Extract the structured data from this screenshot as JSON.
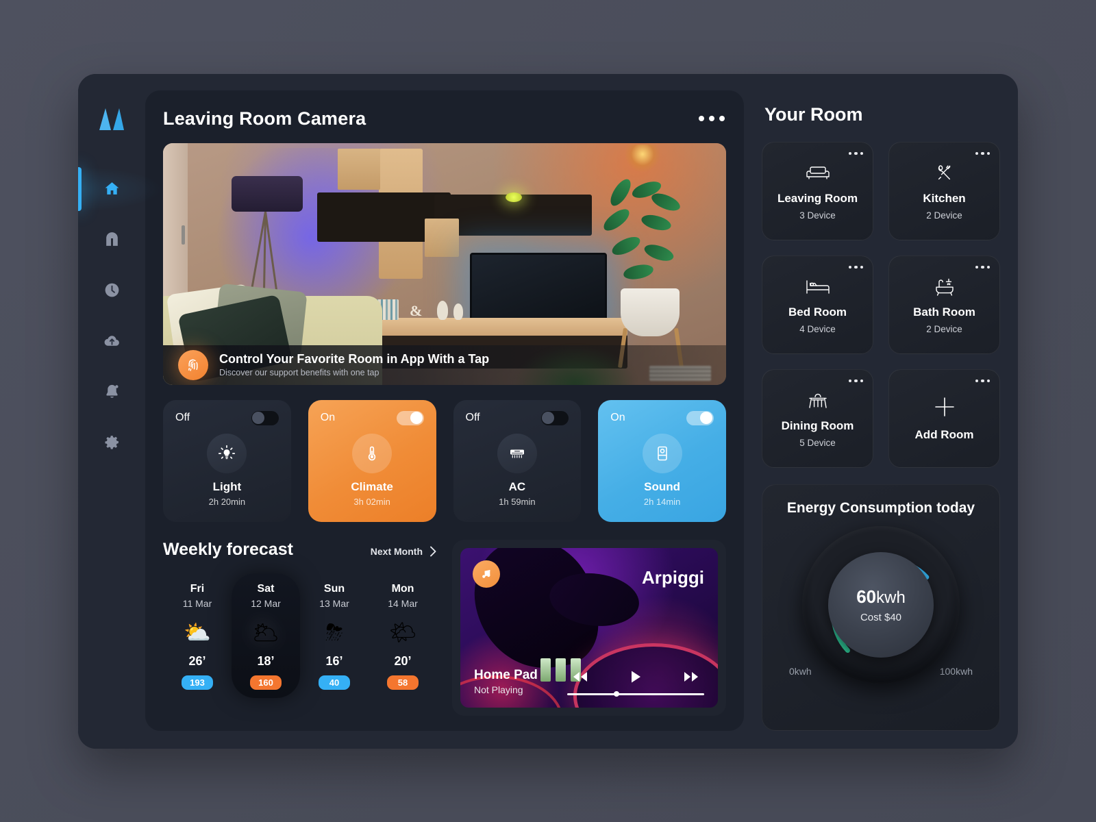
{
  "brand": {
    "logo_name": "app-logo"
  },
  "sidebar": {
    "items": [
      {
        "name": "home",
        "icon": "home-icon",
        "active": true
      },
      {
        "name": "rooms",
        "icon": "arch-door-icon",
        "active": false
      },
      {
        "name": "schedule",
        "icon": "clock-icon",
        "active": false
      },
      {
        "name": "cloud",
        "icon": "cloud-upload-icon",
        "active": false
      },
      {
        "name": "notifications",
        "icon": "bell-icon",
        "active": false
      },
      {
        "name": "settings",
        "icon": "gear-icon",
        "active": false
      }
    ]
  },
  "camera": {
    "title": "Leaving Room Camera",
    "menu_icon": "more-options-icon",
    "banner": {
      "icon": "fingerprint-icon",
      "headline": "Control Your Favorite Room in App With a Tap",
      "subtext": "Discover our support benefits with one tap"
    }
  },
  "devices": [
    {
      "state": "Off",
      "name": "Light",
      "time": "2h 20min",
      "icon": "bulb-icon",
      "on": false,
      "theme": "off"
    },
    {
      "state": "On",
      "name": "Climate",
      "time": "3h 02min",
      "icon": "thermometer-icon",
      "on": true,
      "theme": "orange"
    },
    {
      "state": "Off",
      "name": "AC",
      "time": "1h 59min",
      "icon": "air-conditioner-icon",
      "on": false,
      "theme": "off"
    },
    {
      "state": "On",
      "name": "Sound",
      "time": "2h 14min",
      "icon": "speaker-icon",
      "on": true,
      "theme": "blue"
    }
  ],
  "forecast": {
    "title": "Weekly forecast",
    "next_label": "Next Month",
    "next_icon": "chevron-right-icon",
    "days": [
      {
        "dow": "Fri",
        "date": "11 Mar",
        "icon": "partly-cloudy-day-icon",
        "glyph": "⛅",
        "temp": "26’",
        "badge": "193",
        "badge_color": "#35b0f5",
        "selected": false
      },
      {
        "dow": "Sat",
        "date": "12 Mar",
        "icon": "partly-cloudy-night-icon",
        "glyph": "🌥",
        "temp": "18’",
        "badge": "160",
        "badge_color": "#f4762f",
        "selected": true
      },
      {
        "dow": "Sun",
        "date": "13 Mar",
        "icon": "thunderstorm-icon",
        "glyph": "⛈",
        "temp": "16’",
        "badge": "40",
        "badge_color": "#35b0f5",
        "selected": false
      },
      {
        "dow": "Mon",
        "date": "14 Mar",
        "icon": "sun-haze-icon",
        "glyph": "🌤",
        "temp": "20’",
        "badge": "58",
        "badge_color": "#f4762f",
        "selected": false
      }
    ]
  },
  "music": {
    "badge_icon": "music-note-icon",
    "track": "Arpiggi",
    "device": "Home Pad",
    "status": "Not Playing",
    "prev_icon": "rewind-icon",
    "play_icon": "play-icon",
    "next_icon": "fast-forward-icon"
  },
  "rooms_panel": {
    "title": "Your Room",
    "rooms": [
      {
        "name": "Leaving Room",
        "devices": "3 Device",
        "icon": "sofa-icon",
        "is_add": false
      },
      {
        "name": "Kitchen",
        "devices": "2 Device",
        "icon": "cutlery-icon",
        "is_add": false
      },
      {
        "name": "Bed Room",
        "devices": "4 Device",
        "icon": "bed-icon",
        "is_add": false
      },
      {
        "name": "Bath Room",
        "devices": "2 Device",
        "icon": "bathtub-icon",
        "is_add": false
      },
      {
        "name": "Dining Room",
        "devices": "5 Device",
        "icon": "dining-table-icon",
        "is_add": false
      },
      {
        "name": "Add Room",
        "devices": "",
        "icon": "plus-icon",
        "is_add": true
      }
    ]
  },
  "energy": {
    "title": "Energy Consumption today",
    "value": "60",
    "unit": "kwh",
    "cost": "Cost $40",
    "min_label": "0kwh",
    "max_label": "100kwh",
    "gauge_start_color": "#2ec98e",
    "gauge_end_color": "#35b0f5"
  },
  "colors": {
    "page_bg": "#4b4e5c",
    "app_bg": "#232834",
    "panel_bg": "#1b202b",
    "accent_blue": "#35b0f5",
    "accent_orange": "#f08c37"
  }
}
